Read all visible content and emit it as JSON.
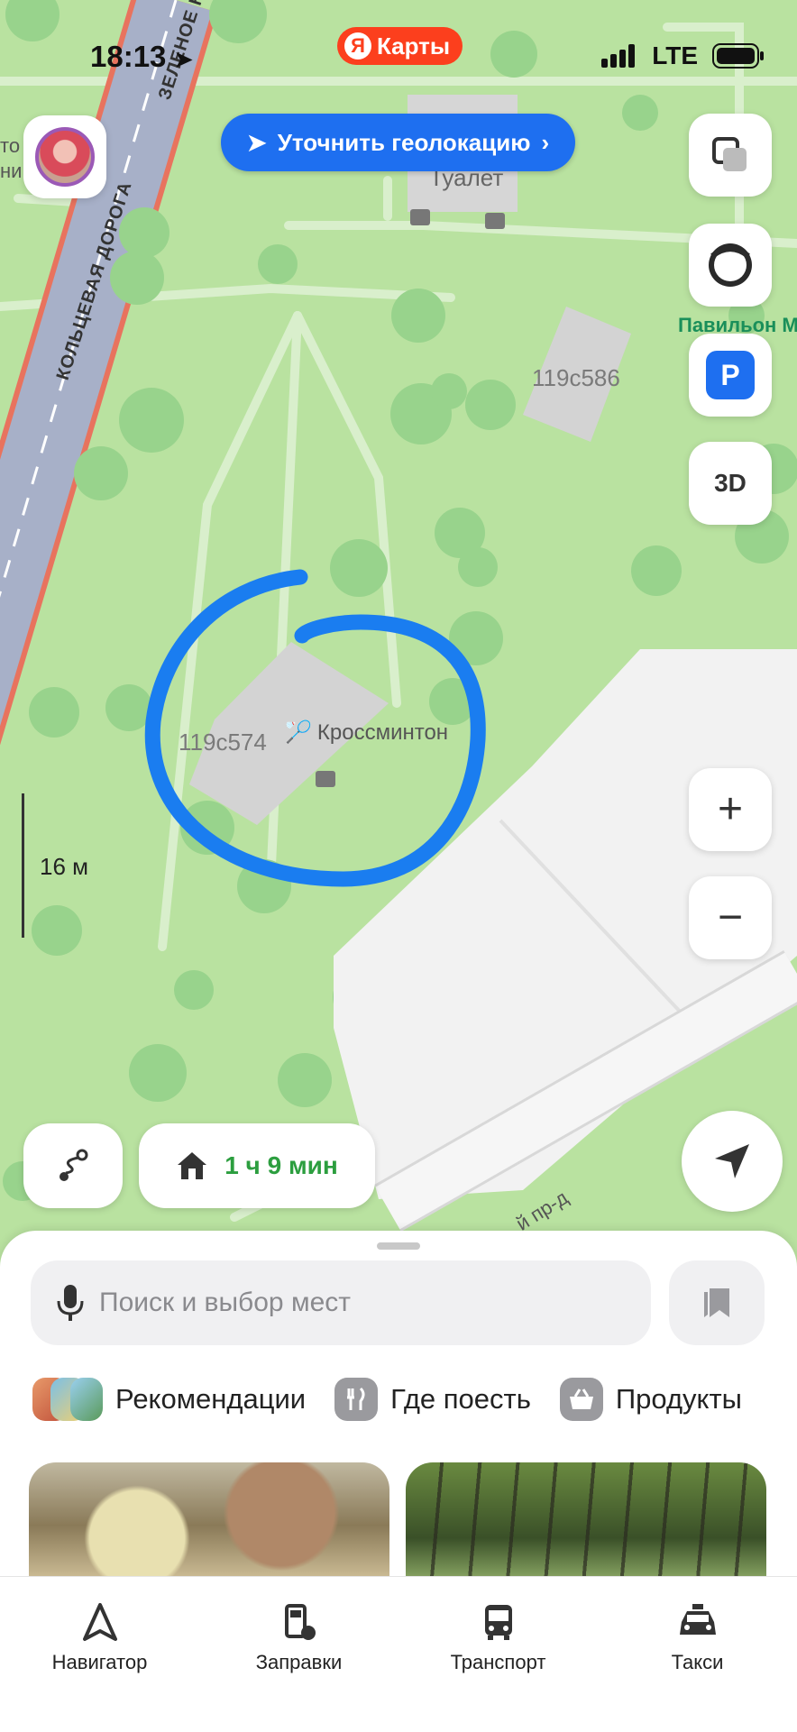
{
  "status_bar": {
    "time": "18:13",
    "network": "LTE"
  },
  "app_badge": {
    "logo": "Я",
    "label": "Карты",
    "color": "#fc3f1d"
  },
  "geo_prompt": {
    "label": "Уточнить геолокацию"
  },
  "map": {
    "labels": {
      "road_ring": "КОЛЬЦЕВАЯ ДОРОГА",
      "road_green": "ЗЕЛЕНОЕ К",
      "toilet": "Туалет",
      "pavilion": "Павильон М",
      "building_a": "119с586",
      "building_b": "119с574",
      "poi": "Кроссминтон",
      "passage": "й пр-д",
      "partial_left": "то\nни"
    },
    "scale": "16 м",
    "colors": {
      "park": "#b9e2a0",
      "road": "#a7b0c8",
      "accent": "#1e6ff0"
    }
  },
  "map_controls": {
    "three_d": "3D",
    "parking": "P"
  },
  "route": {
    "eta": "1 ч 9 мин"
  },
  "search": {
    "placeholder": "Поиск и выбор мест"
  },
  "categories": [
    {
      "label": "Рекомендации",
      "icon": "recommendations-icon"
    },
    {
      "label": "Где поесть",
      "icon": "fork-knife-icon"
    },
    {
      "label": "Продукты",
      "icon": "basket-icon"
    }
  ],
  "tabs": [
    {
      "label": "Навигатор",
      "icon": "navigator-icon"
    },
    {
      "label": "Заправки",
      "icon": "fuel-icon"
    },
    {
      "label": "Транспорт",
      "icon": "bus-icon"
    },
    {
      "label": "Такси",
      "icon": "taxi-icon"
    }
  ]
}
